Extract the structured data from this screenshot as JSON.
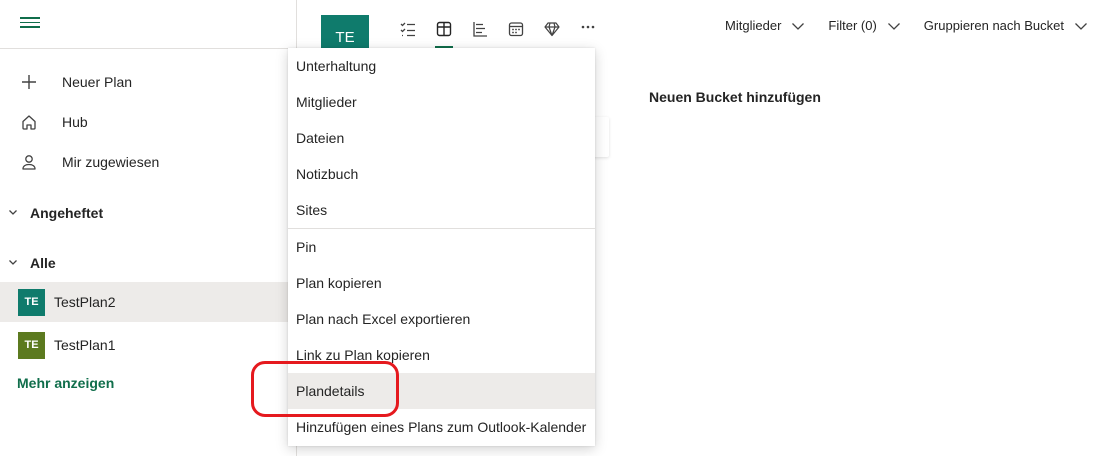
{
  "sidebar": {
    "nav": [
      {
        "label": "Neuer Plan",
        "icon": "plus-icon"
      },
      {
        "label": "Hub",
        "icon": "home-icon"
      },
      {
        "label": "Mir zugewiesen",
        "icon": "person-icon"
      }
    ],
    "sections": [
      {
        "label": "Angeheftet"
      },
      {
        "label": "Alle"
      }
    ],
    "plans": [
      {
        "badge": "TE",
        "label": "TestPlan2",
        "color": "#0f7b6c"
      },
      {
        "badge": "TE",
        "label": "TestPlan1",
        "color": "#5c7a1f"
      }
    ],
    "more_label": "Mehr anzeigen"
  },
  "header": {
    "plan_badge": "TE",
    "members_label": "Mitglieder",
    "filter_label": "Filter (0)",
    "group_label": "Gruppieren nach Bucket"
  },
  "board": {
    "add_bucket_label": "Neuen Bucket hinzufügen"
  },
  "menu": {
    "items": [
      "Unterhaltung",
      "Mitglieder",
      "Dateien",
      "Notizbuch",
      "Sites",
      "Pin",
      "Plan kopieren",
      "Plan nach Excel exportieren",
      "Link zu Plan kopieren",
      "Plandetails",
      "Hinzufügen eines Plans zum Outlook-Kalender"
    ],
    "hovered_item": "Plandetails"
  },
  "colors": {
    "accent": "#106e4b",
    "highlight": "#e5191e"
  }
}
